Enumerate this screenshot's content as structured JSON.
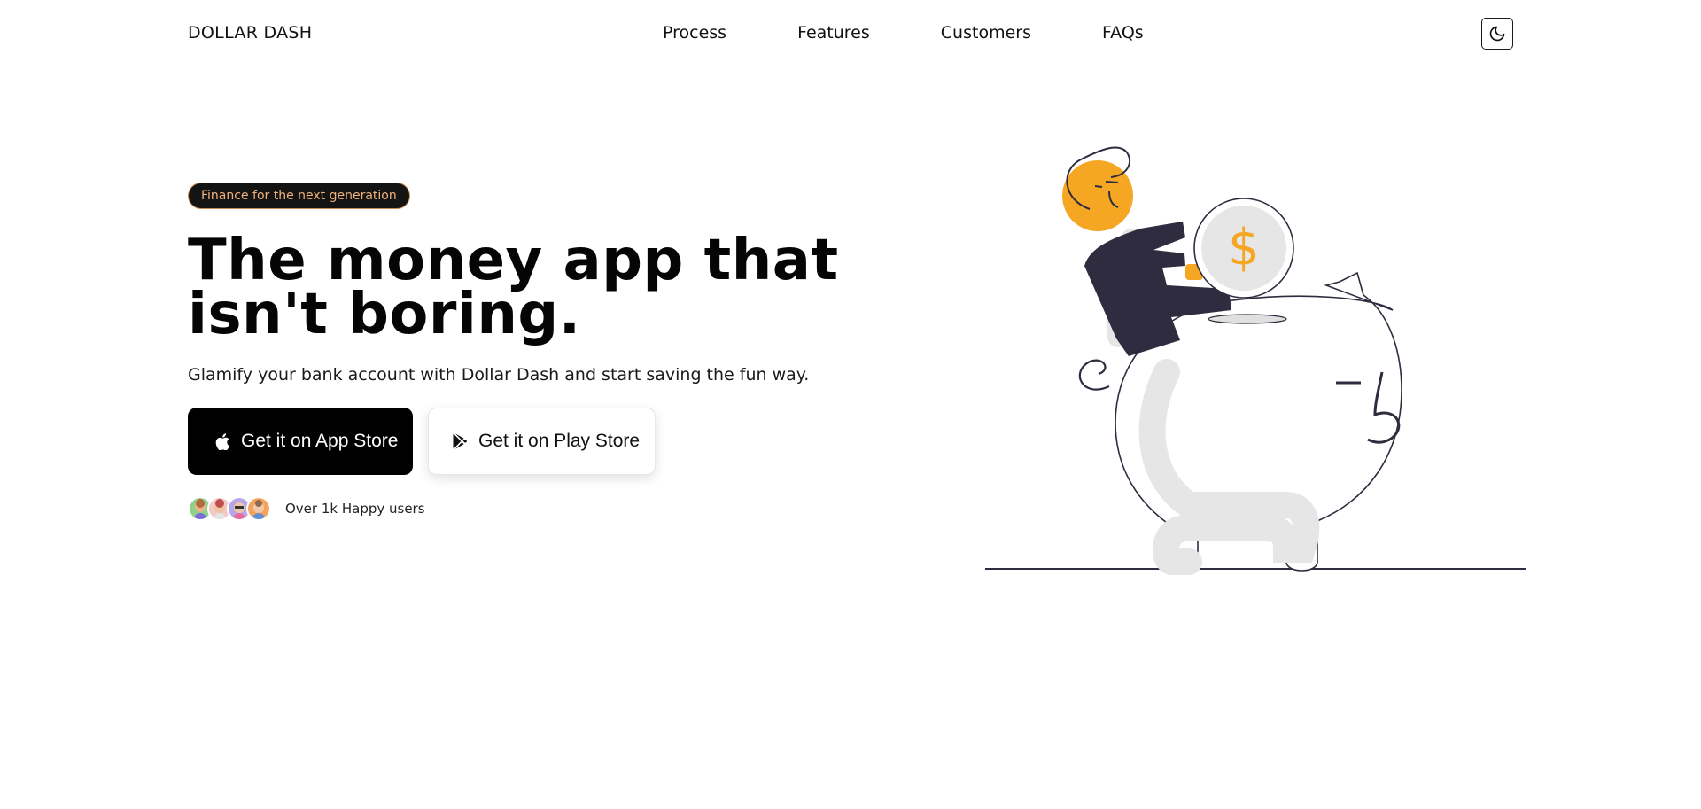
{
  "brand": {
    "name": "DOLLAR DASH"
  },
  "nav": {
    "items": [
      {
        "label": "Process"
      },
      {
        "label": "Features"
      },
      {
        "label": "Customers"
      },
      {
        "label": "FAQs"
      }
    ],
    "theme_toggle_icon": "moon-icon"
  },
  "hero": {
    "badge": "Finance for the next generation",
    "headline": "The money app that isn't boring.",
    "subline": "Glamify your bank account with Dollar Dash and start saving the fun way.",
    "app_store_button": {
      "label": "Get it on App Store",
      "icon": "apple-icon"
    },
    "play_store_button": {
      "label": "Get it on Play Store",
      "icon": "play-store-icon"
    },
    "social_proof": "Over 1k Happy users"
  },
  "illustration": {
    "coin_symbol": "$",
    "colors": {
      "accent": "#f5a623",
      "dark": "#2e2c3e",
      "light": "#e6e6e6"
    }
  }
}
